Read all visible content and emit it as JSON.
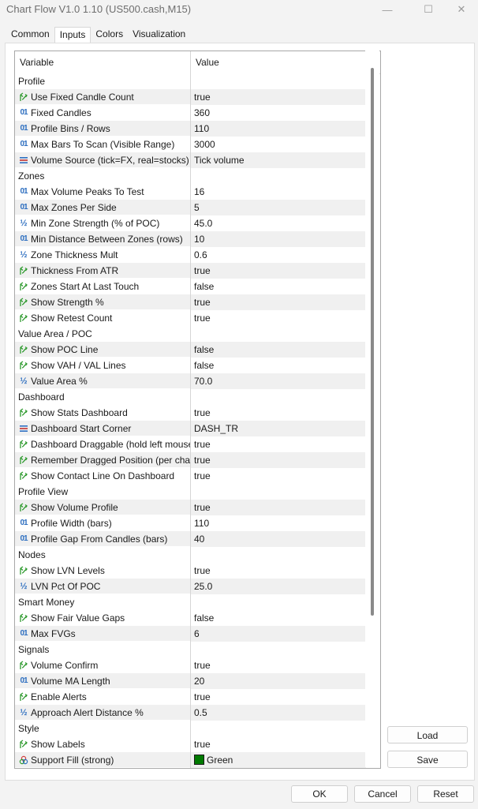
{
  "window": {
    "title": "Chart Flow V1.0 1.10 (US500.cash,M15)",
    "minimize_glyph": "—",
    "maximize_glyph": "☐",
    "close_glyph": "✕"
  },
  "tabs": [
    {
      "label": "Common"
    },
    {
      "label": "Inputs"
    },
    {
      "label": "Colors"
    },
    {
      "label": "Visualization"
    }
  ],
  "grid": {
    "col_variable": "Variable",
    "col_value": "Value",
    "rows": [
      {
        "kind": "group",
        "label": "Profile"
      },
      {
        "kind": "param",
        "icon": "bool-icon",
        "label": "Use Fixed Candle Count",
        "value": "true"
      },
      {
        "kind": "param",
        "icon": "int-icon",
        "label": "Fixed Candles",
        "value": "360"
      },
      {
        "kind": "param",
        "icon": "int-icon",
        "label": "Profile Bins / Rows",
        "value": "110"
      },
      {
        "kind": "param",
        "icon": "int-icon",
        "label": "Max Bars To Scan (Visible Range)",
        "value": "3000"
      },
      {
        "kind": "param",
        "icon": "enum-icon",
        "label": "Volume Source (tick=FX, real=stocks)",
        "value": "Tick volume"
      },
      {
        "kind": "group",
        "label": "Zones"
      },
      {
        "kind": "param",
        "icon": "int-icon",
        "label": "Max Volume Peaks To Test",
        "value": "16"
      },
      {
        "kind": "param",
        "icon": "int-icon",
        "label": "Max Zones Per Side",
        "value": "5"
      },
      {
        "kind": "param",
        "icon": "double-icon",
        "label": "Min Zone Strength (% of POC)",
        "value": "45.0"
      },
      {
        "kind": "param",
        "icon": "int-icon",
        "label": "Min Distance Between Zones (rows)",
        "value": "10"
      },
      {
        "kind": "param",
        "icon": "double-icon",
        "label": "Zone Thickness Mult",
        "value": "0.6"
      },
      {
        "kind": "param",
        "icon": "bool-icon",
        "label": "Thickness From ATR",
        "value": "true"
      },
      {
        "kind": "param",
        "icon": "bool-icon",
        "label": "Zones Start At Last Touch",
        "value": "false"
      },
      {
        "kind": "param",
        "icon": "bool-icon",
        "label": "Show Strength %",
        "value": "true"
      },
      {
        "kind": "param",
        "icon": "bool-icon",
        "label": "Show Retest Count",
        "value": "true"
      },
      {
        "kind": "group",
        "label": "Value Area / POC"
      },
      {
        "kind": "param",
        "icon": "bool-icon",
        "label": "Show POC Line",
        "value": "false"
      },
      {
        "kind": "param",
        "icon": "bool-icon",
        "label": "Show VAH / VAL Lines",
        "value": "false"
      },
      {
        "kind": "param",
        "icon": "double-icon",
        "label": "Value Area %",
        "value": "70.0"
      },
      {
        "kind": "group",
        "label": "Dashboard"
      },
      {
        "kind": "param",
        "icon": "bool-icon",
        "label": "Show Stats Dashboard",
        "value": "true"
      },
      {
        "kind": "param",
        "icon": "enum-icon",
        "label": "Dashboard Start Corner",
        "value": "DASH_TR"
      },
      {
        "kind": "param",
        "icon": "bool-icon",
        "label": "Dashboard Draggable (hold left mouse)",
        "value": "true"
      },
      {
        "kind": "param",
        "icon": "bool-icon",
        "label": "Remember Dragged Position (per chart)",
        "value": "true"
      },
      {
        "kind": "param",
        "icon": "bool-icon",
        "label": "Show Contact Line On Dashboard",
        "value": "true"
      },
      {
        "kind": "group",
        "label": "Profile View"
      },
      {
        "kind": "param",
        "icon": "bool-icon",
        "label": "Show Volume Profile",
        "value": "true"
      },
      {
        "kind": "param",
        "icon": "int-icon",
        "label": "Profile Width (bars)",
        "value": "110"
      },
      {
        "kind": "param",
        "icon": "int-icon",
        "label": "Profile Gap From Candles (bars)",
        "value": "40"
      },
      {
        "kind": "group",
        "label": "Nodes"
      },
      {
        "kind": "param",
        "icon": "bool-icon",
        "label": "Show LVN Levels",
        "value": "true"
      },
      {
        "kind": "param",
        "icon": "double-icon",
        "label": "LVN Pct Of POC",
        "value": "25.0"
      },
      {
        "kind": "group",
        "label": "Smart Money"
      },
      {
        "kind": "param",
        "icon": "bool-icon",
        "label": "Show Fair Value Gaps",
        "value": "false"
      },
      {
        "kind": "param",
        "icon": "int-icon",
        "label": "Max FVGs",
        "value": "6"
      },
      {
        "kind": "group",
        "label": "Signals"
      },
      {
        "kind": "param",
        "icon": "bool-icon",
        "label": "Volume Confirm",
        "value": "true"
      },
      {
        "kind": "param",
        "icon": "int-icon",
        "label": "Volume MA Length",
        "value": "20"
      },
      {
        "kind": "param",
        "icon": "bool-icon",
        "label": "Enable Alerts",
        "value": "true"
      },
      {
        "kind": "param",
        "icon": "double-icon",
        "label": "Approach Alert Distance %",
        "value": "0.5"
      },
      {
        "kind": "group",
        "label": "Style"
      },
      {
        "kind": "param",
        "icon": "bool-icon",
        "label": "Show Labels",
        "value": "true"
      },
      {
        "kind": "param",
        "icon": "color-icon",
        "label": "Support Fill (strong)",
        "value": "Green",
        "swatch": "#007a00"
      }
    ]
  },
  "icon_glyphs": {
    "int-icon": "01",
    "double-icon": "½"
  },
  "side_buttons": {
    "load": "Load",
    "save": "Save"
  },
  "footer": {
    "ok": "OK",
    "cancel": "Cancel",
    "reset": "Reset"
  },
  "colors": {
    "bool_icon": "#2e9a2e",
    "int_icon": "#2e6fc0",
    "swatch_green": "#007a00"
  }
}
